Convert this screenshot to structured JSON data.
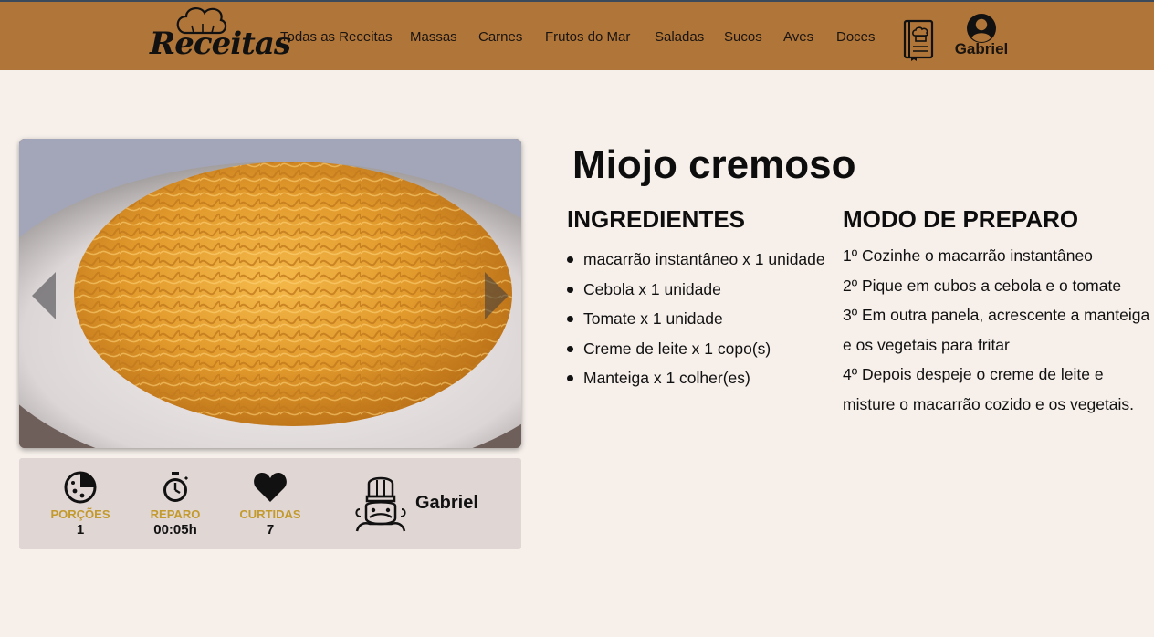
{
  "header": {
    "logo_text": "Receitas",
    "nav": [
      {
        "label": "Todas as Receitas",
        "id": "todas"
      },
      {
        "label": "Massas",
        "id": "massas"
      },
      {
        "label": "Carnes",
        "id": "carnes"
      },
      {
        "label": "Frutos do Mar",
        "id": "frutos"
      },
      {
        "label": "Saladas",
        "id": "saladas"
      },
      {
        "label": "Sucos",
        "id": "sucos"
      },
      {
        "label": "Aves",
        "id": "aves"
      },
      {
        "label": "Doces",
        "id": "doces"
      }
    ],
    "user_name": "Gabriel",
    "icons": {
      "book": "recipe-book-icon",
      "user": "user-avatar-icon"
    }
  },
  "recipe": {
    "title": "Miojo cremoso",
    "image_alt": "Prato de macarrão instantâneo",
    "ingredients_title": "INGREDIENTES",
    "ingredients": [
      "macarrão instantâneo x 1 unidade",
      "Cebola x 1 unidade",
      "Tomate x 1 unidade",
      "Creme de leite x 1 copo(s)",
      "Manteiga x 1 colher(es)"
    ],
    "steps_title": "MODO DE PREPARO",
    "steps": [
      "1º Cozinhe o macarrão instantâneo",
      "2º Pique em cubos a cebola e o tomate",
      "3º Em outra panela, acrescente a manteiga e os vegetais para fritar",
      "4º Depois despeje o creme de leite e misture o macarrão cozido e os vegetais."
    ]
  },
  "stats": {
    "portions": {
      "label": "PORÇÕES",
      "value": "1",
      "icon": "pizza-icon"
    },
    "prep": {
      "label": "REPARO",
      "value": "00:05h",
      "icon": "stopwatch-icon"
    },
    "likes": {
      "label": "CURTIDAS",
      "value": "7",
      "icon": "heart-icon"
    },
    "author": {
      "name": "Gabriel",
      "icon": "chef-icon"
    }
  },
  "colors": {
    "header_bg": "#b07538",
    "page_bg": "#f6efea",
    "stats_bg": "#e0d6d4",
    "stat_label": "#c39a2d"
  }
}
